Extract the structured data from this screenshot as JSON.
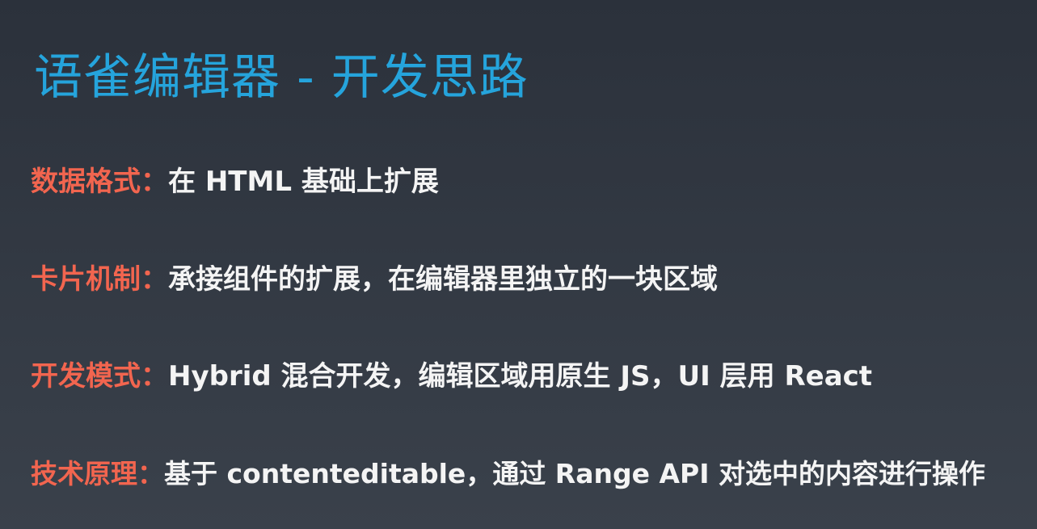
{
  "title": "语雀编辑器 - 开发思路",
  "separator": "：",
  "items": [
    {
      "label": "数据格式",
      "text": "在 HTML 基础上扩展"
    },
    {
      "label": "卡片机制",
      "text": "承接组件的扩展，在编辑器里独立的一块区域"
    },
    {
      "label": "开发模式",
      "text": "Hybrid 混合开发，编辑区域用原生 JS，UI 层用 React"
    },
    {
      "label": "技术原理",
      "text": "基于 contenteditable，通过 Range API 对选中的内容进行操作"
    }
  ],
  "colors": {
    "title": "#25a4dc",
    "label": "#f2654f",
    "text": "#f4f4f4",
    "background_top": "#2b313b",
    "background_bottom": "#3a414b"
  }
}
